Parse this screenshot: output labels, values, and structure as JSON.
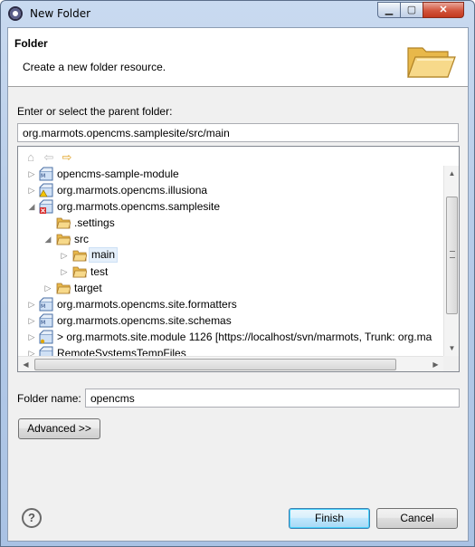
{
  "window": {
    "title": "New Folder",
    "min_label": "▁",
    "max_label": "▢",
    "close_label": "✕"
  },
  "header": {
    "title": "Folder",
    "description": "Create a new folder resource."
  },
  "parent": {
    "label": "Enter or select the parent folder:",
    "value": "org.marmots.opencms.samplesite/src/main"
  },
  "tree": {
    "items": [
      {
        "label": "opencms-sample-module",
        "expanded": false,
        "type": "project"
      },
      {
        "label": "org.marmots.opencms.illusiona",
        "expanded": false,
        "type": "project-warning"
      },
      {
        "label": "org.marmots.opencms.samplesite",
        "expanded": true,
        "type": "project-error"
      },
      {
        "label": ".settings",
        "expanded": null,
        "type": "folder"
      },
      {
        "label": "src",
        "expanded": true,
        "type": "folder"
      },
      {
        "label": "main",
        "expanded": false,
        "type": "folder",
        "selected": true
      },
      {
        "label": "test",
        "expanded": false,
        "type": "folder"
      },
      {
        "label": "target",
        "expanded": false,
        "type": "folder"
      },
      {
        "label": "org.marmots.opencms.site.formatters",
        "expanded": false,
        "type": "project"
      },
      {
        "label": "org.marmots.opencms.site.schemas",
        "expanded": false,
        "type": "project"
      },
      {
        "label": "> org.marmots.site.module 1126 [https://localhost/svn/marmots, Trunk: org.ma",
        "expanded": false,
        "type": "project"
      },
      {
        "label": "RemoteSystemsTempFiles",
        "expanded": false,
        "type": "project"
      }
    ]
  },
  "folder_name": {
    "label": "Folder name:",
    "value": "opencms"
  },
  "buttons": {
    "advanced": "Advanced >>",
    "finish": "Finish",
    "cancel": "Cancel",
    "help": "?"
  },
  "colors": {
    "title_gradient_top": "#c9daf0",
    "dialog_bg": "#f0f0f0",
    "folder_yellow": "#f5d07a",
    "selection": "#e5f0fb",
    "close_red": "#d2543c"
  }
}
